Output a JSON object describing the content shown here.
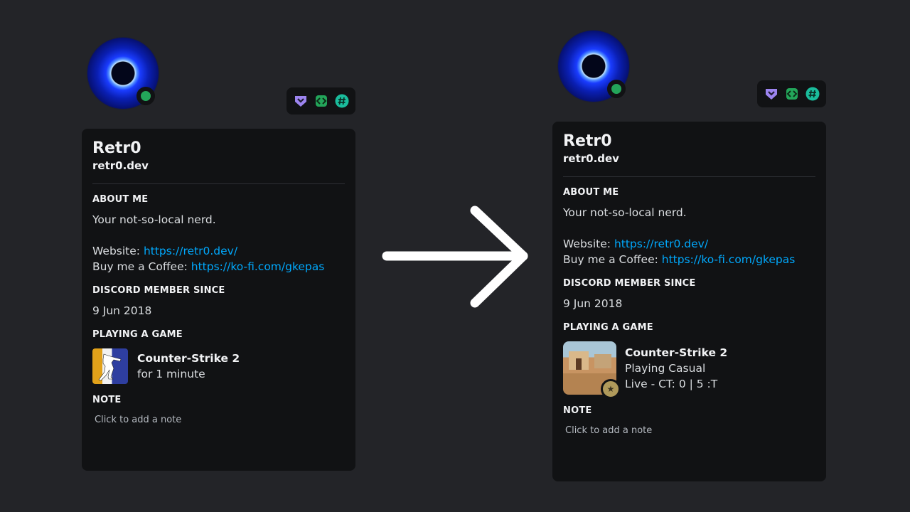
{
  "before": {
    "display_name": "Retr0",
    "username": "retr0.dev",
    "about_title": "ABOUT ME",
    "about_text": "Your not-so-local nerd.",
    "website_label": "Website: ",
    "website_url": "https://retr0.dev/",
    "coffee_label": "Buy me a Coffee: ",
    "coffee_url": "https://ko-fi.com/gkepas",
    "member_since_title": "DISCORD MEMBER SINCE",
    "member_since": "9 Jun 2018",
    "playing_title": "PLAYING A GAME",
    "game_name": "Counter-Strike 2",
    "game_detail1": "for 1 minute",
    "note_title": "NOTE",
    "note_placeholder": "Click to add a note"
  },
  "after": {
    "display_name": "Retr0",
    "username": "retr0.dev",
    "about_title": "ABOUT ME",
    "about_text": "Your not-so-local nerd.",
    "website_label": "Website: ",
    "website_url": "https://retr0.dev/",
    "coffee_label": "Buy me a Coffee: ",
    "coffee_url": "https://ko-fi.com/gkepas",
    "member_since_title": "DISCORD MEMBER SINCE",
    "member_since": "9 Jun 2018",
    "playing_title": "PLAYING A GAME",
    "game_name": "Counter-Strike 2",
    "game_detail1": "Playing Casual",
    "game_detail2": "Live - CT: 0 | 5 :T",
    "note_title": "NOTE",
    "note_placeholder": "Click to add a note"
  },
  "badges": [
    "hypesquad-balance-icon",
    "active-developer-icon",
    "hashtag-icon"
  ],
  "colors": {
    "background": "#232428",
    "card": "#111214",
    "link": "#00a8fc",
    "online": "#23a55a",
    "hypesquad": "#9c84ef",
    "developer": "#23a55a",
    "hashtag": "#1abc9c"
  }
}
